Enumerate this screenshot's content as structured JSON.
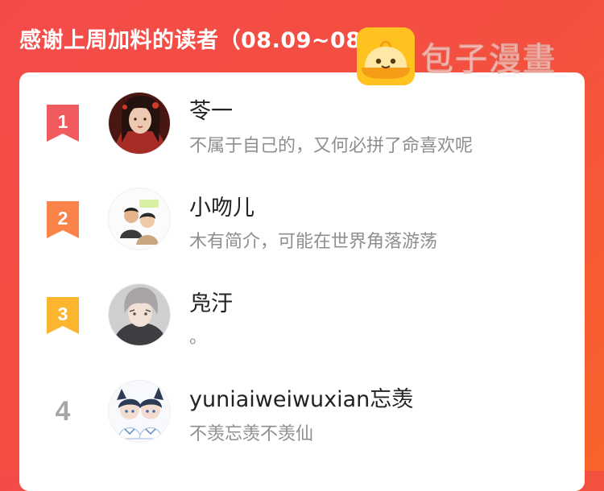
{
  "header": {
    "title": "感谢上周加料的读者（08.09~08.15）"
  },
  "watermark": {
    "text": "包子漫畫",
    "logo_icon": "baozi-logo-icon"
  },
  "colors": {
    "background": "#f44b4a",
    "rank1": "#f25b5e",
    "rank2": "#fa8349",
    "rank3": "#fbb52e",
    "rank4": "#a6a6a6"
  },
  "readers": [
    {
      "rank": "1",
      "name": "苓一",
      "description": "不属于自己的，又何必拼了命喜欢呢"
    },
    {
      "rank": "2",
      "name": "小吻儿",
      "description": "木有简介，可能在世界角落游荡"
    },
    {
      "rank": "3",
      "name": "凫汙",
      "description": "。"
    },
    {
      "rank": "4",
      "name": "yuniaiweiwuxian忘羡",
      "description": "不羡忘羡不羡仙"
    }
  ]
}
